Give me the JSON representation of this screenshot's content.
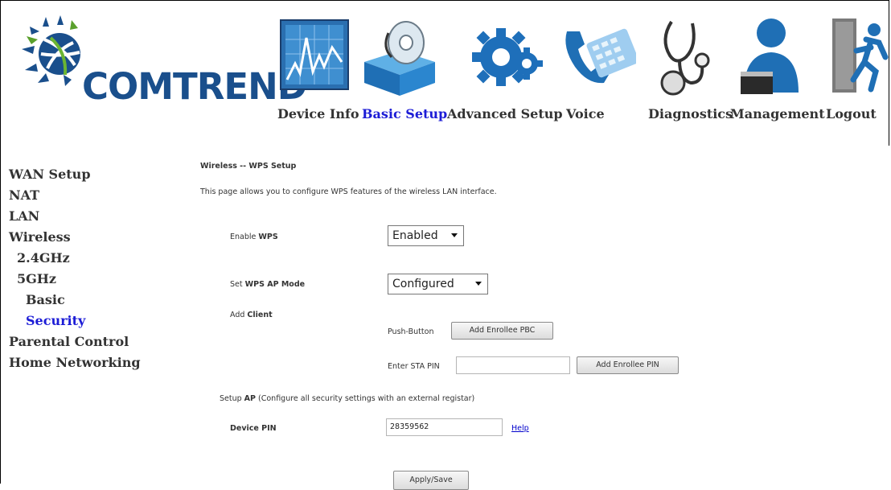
{
  "brand": {
    "name": "COMTREND"
  },
  "nav": {
    "device_info": "Device Info",
    "basic_setup": "Basic Setup",
    "advanced_setup": "Advanced Setup",
    "voice": "Voice",
    "diagnostics": "Diagnostics",
    "management": "Management",
    "logout": "Logout",
    "active": "Basic Setup",
    "active_color": "#1c1cd6"
  },
  "sidebar": {
    "items": [
      {
        "label": "WAN Setup"
      },
      {
        "label": "NAT"
      },
      {
        "label": "LAN"
      },
      {
        "label": "Wireless"
      },
      {
        "label": "2.4GHz"
      },
      {
        "label": "5GHz"
      },
      {
        "label": "Basic"
      },
      {
        "label": "Security"
      },
      {
        "label": "Parental Control"
      },
      {
        "label": "Home Networking"
      }
    ],
    "active": "Security"
  },
  "page": {
    "title": "Wireless -- WPS Setup",
    "description": "This page allows you to configure WPS features of the wireless LAN interface.",
    "enable_wps_prefix": "Enable ",
    "enable_wps_bold": "WPS",
    "enable_wps_value": "Enabled",
    "set_ap_mode_prefix": "Set ",
    "set_ap_mode_bold": "WPS AP Mode",
    "ap_mode_value": "Configured",
    "add_client_prefix": "Add ",
    "add_client_bold": "Client",
    "push_button_label": "Push-Button",
    "add_enrollee_pbc": "Add Enrollee PBC",
    "enter_sta_pin_label": "Enter STA PIN",
    "sta_pin_value": "",
    "add_enrollee_pin": "Add Enrollee PIN",
    "setup_ap_prefix": "Setup ",
    "setup_ap_bold": "AP",
    "setup_ap_suffix": " (Configure all security settings with an external registar)",
    "device_pin_label": "Device PIN",
    "device_pin_value": "28359562",
    "help_link": "Help",
    "apply_save": "Apply/Save"
  },
  "icons": [
    "comtrend-logo-icon",
    "device-info-icon",
    "basic-setup-icon",
    "advanced-setup-icon",
    "voice-icon",
    "diagnostics-icon",
    "management-icon",
    "logout-icon"
  ]
}
